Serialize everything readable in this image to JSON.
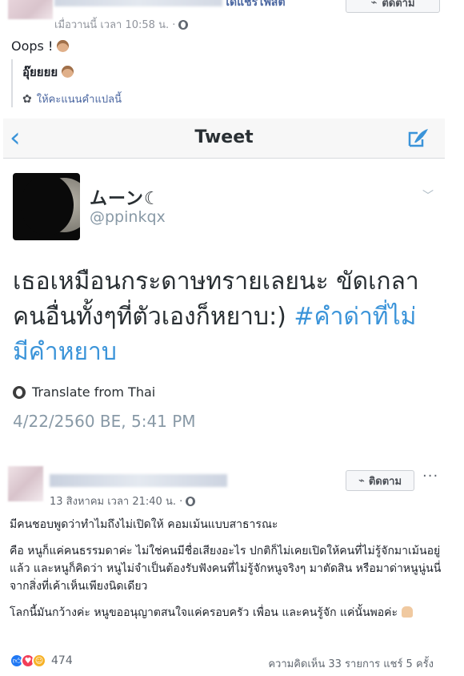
{
  "post1": {
    "page_link": "ไดแชร์โพสต์",
    "follow_label": "ติดตาม",
    "timestamp": "เมื่อวานนี้ เวลา 10:58 น. ·",
    "text": "Oops !",
    "translation": "อุ๊ยยยย",
    "rate_translation": "ให้คะแนนคำแปลนี้"
  },
  "tweet": {
    "header_title": "Tweet",
    "display_name": "ムーン☾",
    "handle": "@ppinkqx",
    "text_line1": "เธอเหมือนกระดาษทรายเลยนะ ขัดเกลา",
    "text_line2": "คนอื่นทั้งๆที่ตัวเองก็หยาบ:) ",
    "hashtag_part1": "#คำด่าที่ไม่",
    "hashtag_part2": "มีคำหยาบ",
    "translate_label": "Translate from Thai",
    "datetime": "4/22/2560 BE, 5:41 PM"
  },
  "post2": {
    "follow_label": "ติดตาม",
    "more": "···",
    "timestamp": "13 สิงหาคม เวลา 21:40 น. ·",
    "paragraph1": "มีคนชอบพูดว่าทำไมถึงไม่เปิดให้ คอมเม้นแบบสาธารณะ",
    "paragraph2": "คือ หนูก็แค่คนธรรมดาค่ะ ไม่ใช่คนมีชื่อเสียงอะไร ปกติก็ไม่เคยเปิดให้คนที่ไม่รู้จักมาเม้นอยู่แล้ว และหนูก็คิดว่า หนูไม่จำเป็นต้องรับฟังคนที่ไม่รู้จักหนูจริงๆ มาตัดสิน หรือมาด่าหนูนู่นนี่จากสิ่งที่เค้าเห็นเพียงนิดเดียว",
    "paragraph3": "โลกนี้มันกว้างค่ะ หนูขออนุญาตสนใจแค่ครอบครัว เพื่อน และคนรู้จัก แค่นั้นพอค่ะ",
    "reaction_count": "474",
    "stats": "ความคิดเห็น 33 รายการ  แชร์ 5 ครั้ง"
  },
  "colors": {
    "link": "#4b67a1",
    "twitter_blue": "#3b94d9",
    "meta_gray": "#90949c"
  },
  "icons": [
    "globe-icon",
    "gear-icon",
    "back-arrow-icon",
    "compose-icon",
    "chevron-down-icon",
    "rss-follow-icon",
    "like-icon",
    "love-icon",
    "haha-icon"
  ]
}
